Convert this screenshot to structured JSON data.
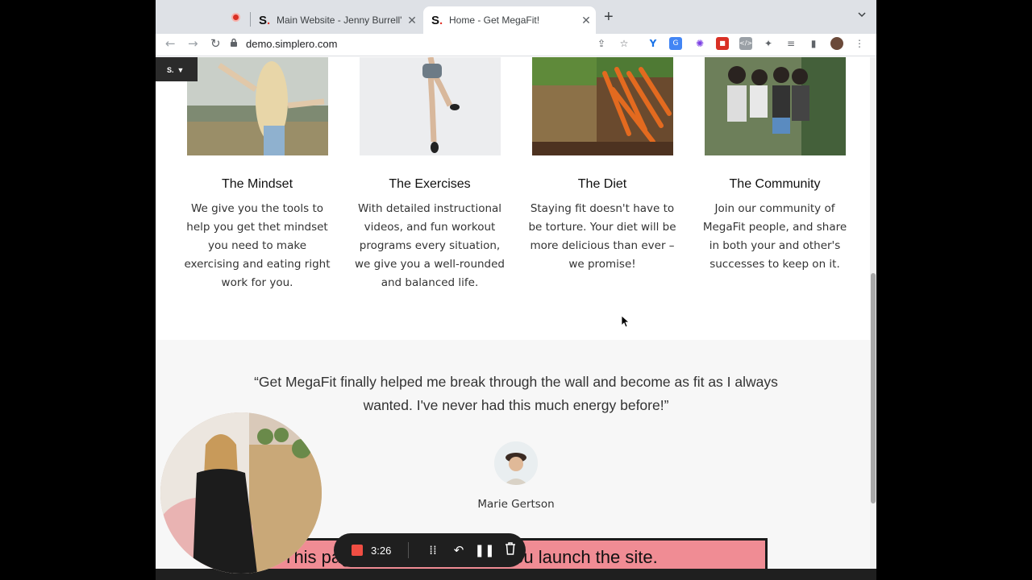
{
  "browser": {
    "tabs": [
      {
        "title": "Main Website - Jenny Burrell's",
        "favicon": "S.",
        "active": false
      },
      {
        "title": "Home - Get MegaFit!",
        "favicon": "S.",
        "active": true
      }
    ],
    "url": "demo.simplero.com",
    "new_tab": "+",
    "close": "✕"
  },
  "badge": {
    "logo": "S."
  },
  "features": [
    {
      "title": "The Mindset",
      "text": "We give you the tools to help you get thet mindset you need to make exercising and eating right work for you."
    },
    {
      "title": "The Exercises",
      "text": "With detailed instructional videos, and fun workout programs every situation, we give you a well-rounded and balanced life."
    },
    {
      "title": "The Diet",
      "text": "Staying fit doesn't have to be torture. Your diet will be more delicious than ever – we promise!"
    },
    {
      "title": "The Community",
      "text": "Join our community of MegaFit people, and share in both your and other's successes to keep on it."
    }
  ],
  "testimonial": {
    "quote": "“Get MegaFit finally helped me break through the wall and become as fit as I always wanted. I've never had this much energy before!”",
    "author": "Marie Gertson"
  },
  "launch_banner": {
    "text": "This page is not visible until you launch the site."
  },
  "recorder": {
    "time": "3:26"
  },
  "colors": {
    "accent_red": "#e2352a",
    "banner_pink": "#f08c94",
    "testimonial_bg": "#f7f7f7"
  }
}
